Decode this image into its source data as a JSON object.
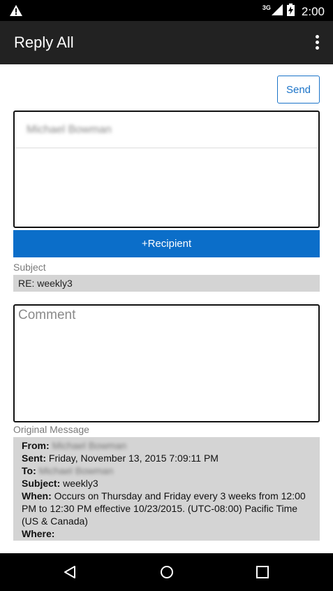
{
  "status_bar": {
    "network": "3G",
    "time": "2:00",
    "icons": [
      "warning-icon",
      "signal-icon",
      "battery-icon"
    ]
  },
  "app_bar": {
    "title": "Reply All",
    "menu_icon": "overflow-menu-icon"
  },
  "compose": {
    "send_label": "Send",
    "recipients": [
      "Michael Bowman"
    ],
    "add_recipient_label": "+Recipient",
    "subject_label": "Subject",
    "subject_value": "RE: weekly3",
    "comment_placeholder": "Comment"
  },
  "original_message": {
    "label": "Original Message",
    "from_label": "From:",
    "from_value": "Michael Bowman",
    "sent_label": "Sent:",
    "sent_value": "Friday, November 13, 2015 7:09:11 PM",
    "to_label": "To:",
    "to_value": "Michael Bowman",
    "subject_label": "Subject:",
    "subject_value": "weekly3",
    "when_label": "When:",
    "when_value": "Occurs on Thursday and Friday every 3 weeks from 12:00 PM to 12:30 PM effective 10/23/2015. (UTC-08:00) Pacific Time (US & Canada)",
    "where_label": "Where:"
  },
  "nav_bar": {
    "icons": [
      "back-icon",
      "home-icon",
      "recents-icon"
    ]
  },
  "colors": {
    "accent": "#0b6ec9",
    "app_bar": "#222222",
    "field_bg": "#d4d4d4"
  }
}
